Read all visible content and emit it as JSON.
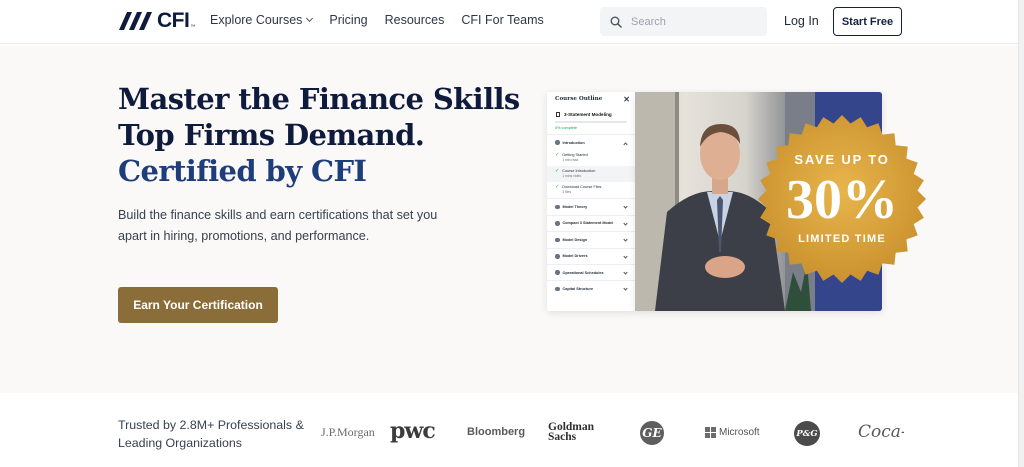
{
  "header": {
    "logo_text": "CFI",
    "logo_tm": "™",
    "nav": [
      {
        "label": "Explore Courses",
        "has_dropdown": true
      },
      {
        "label": "Pricing"
      },
      {
        "label": "Resources"
      },
      {
        "label": "CFI For Teams"
      }
    ],
    "search": {
      "placeholder": "Search",
      "icon": "search-icon"
    },
    "login_label": "Log In",
    "start_free_label": "Start Free"
  },
  "hero": {
    "title_line1": "Master the Finance Skills",
    "title_line2": "Top Firms Demand.",
    "title_line3": "Certified by CFI",
    "subtitle": "Build the finance skills and earn certifications that set you apart in hiring, promotions, and performance.",
    "cta_label": "Earn Your Certification"
  },
  "course_panel": {
    "header": "Course Outline",
    "course_name": "3-Statement Modeling",
    "progress_text": "0% complete",
    "progress_fraction": 0,
    "open_section": "Introduction",
    "lessons": [
      {
        "title": "Getting Started",
        "meta": "1 min read",
        "active": false
      },
      {
        "title": "Course Introduction",
        "meta": "1 mins video",
        "active": true
      },
      {
        "title": "Download Course Files",
        "meta": "3 files",
        "active": false
      }
    ],
    "sections": [
      "Model Theory",
      "Compact 3 Statement Model",
      "Model Design",
      "Model Drivers",
      "Operational Schedules",
      "Capital Structure"
    ]
  },
  "promo_badge": {
    "line1": "SAVE UP TO",
    "percent": "30%",
    "line2": "LIMITED TIME",
    "color": "#d9a23a"
  },
  "trust": {
    "text": "Trusted by 2.8M+ Professionals & Leading Organizations",
    "logos": {
      "jpmorgan": "J.P.Morgan",
      "pwc": "pwc",
      "bloomberg": "Bloomberg",
      "goldman_line1": "Goldman",
      "goldman_line2": "Sachs",
      "ge": "GE",
      "microsoft": "Microsoft",
      "pg": "P&G",
      "cocacola": "Coca-Cola"
    }
  },
  "colors": {
    "navy": "#0f1b3d",
    "blue_accent": "#1e3d7b",
    "cta_gold": "#8b6d3a",
    "badge_gold": "#d9a23a"
  }
}
